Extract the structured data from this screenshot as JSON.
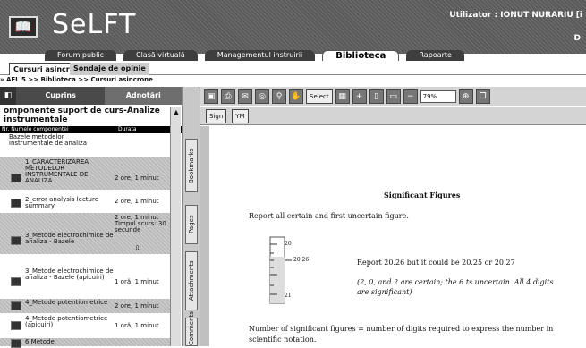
{
  "app": {
    "title": "SeLFT",
    "logo_glyph": "📖"
  },
  "user": {
    "label": "Utilizator : IONUT NURARIU [i",
    "sub": "D"
  },
  "nav": {
    "tabs": [
      "Forum public",
      "Clasă virtuală",
      "Managementul instruirii",
      "Biblioteca",
      "Rapoarte"
    ],
    "active": "Biblioteca"
  },
  "subtabs": {
    "first": "Cursuri asincrone",
    "second": "Sondaje de opinie"
  },
  "breadcrumb": "» AEL 5 >> Biblioteca >> Cursuri asincrone",
  "left_panel": {
    "tab_content": "Cuprins",
    "tab_notes": "Adnotări",
    "title": "omponente suport de curs-Analize instrumentale",
    "col_name": "Nr. Numele componentei",
    "col_duration": "Durata",
    "rows": [
      {
        "name": "Bazele metodelor instrumentale de analiza",
        "duration": ""
      },
      {
        "name": "1_CARACTERIZAREA METODELOR INSTRUMENTALE DE ANALIZA",
        "duration": "2 ore, 1 minut"
      },
      {
        "name": "2_error analysis lecture summary",
        "duration": "2 ore, 1 minut"
      },
      {
        "name": "3_Metode electrochimice de analiza - Bazele",
        "duration": "2 ore, 1 minut Timpul scurs: 30 secunde"
      },
      {
        "name": "3_Metode electrochimice de analiza - Bazele (apicuiri)",
        "duration": "1 oră, 1 minut"
      },
      {
        "name": "4_Metode potentiometrice",
        "duration": "2 ore, 1 minut"
      },
      {
        "name": "4_Metode potentiometrice (apicuiri)",
        "duration": "1 oră, 1 minut"
      },
      {
        "name": "6 Metode",
        "duration": ""
      }
    ]
  },
  "side_tabs": [
    "Bookmarks",
    "Pages",
    "Attachments",
    "Comments"
  ],
  "toolbar": {
    "select_label": "Select",
    "zoom_value": "79%",
    "sign_label": "Sign"
  },
  "document": {
    "title": "Significant Figures",
    "line1": "Report all certain and first uncertain figure.",
    "line2": "Report 20.26 but it could be 20.25 or 20.27",
    "line3": "(2, 0, and 2 are certain; the 6 ts uncertain.  All 4 digits",
    "line4": "are significant)",
    "line5": "Number of significant figures = number of digits required to express the number in",
    "line6": "scientific notation.",
    "tube_labels": [
      "20",
      "20.26",
      "21"
    ]
  }
}
